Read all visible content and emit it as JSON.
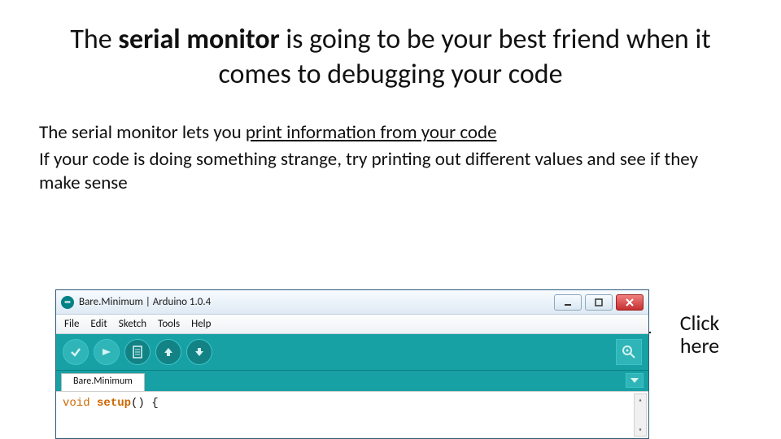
{
  "title": {
    "pre": "The ",
    "bold": "serial monitor",
    "post": " is going to be your best friend when it comes to debugging your code"
  },
  "body": {
    "line1_pre": "The serial monitor lets you ",
    "line1_u": "print information from your code",
    "line2": "If your code is doing something strange, try printing out different values and see if they make sense"
  },
  "annotation": {
    "l1": "Click",
    "l2": "here"
  },
  "arduino": {
    "app_icon_text": "∞",
    "window_title": "Bare.Minimum | Arduino 1.0.4",
    "menu": {
      "file": "File",
      "edit": "Edit",
      "sketch": "Sketch",
      "tools": "Tools",
      "help": "Help"
    },
    "toolbar_icons": {
      "verify": "verify-icon",
      "upload": "upload-icon",
      "new": "new-icon",
      "open": "open-icon",
      "save": "save-icon",
      "serial": "serial-monitor-icon"
    },
    "tab_name": "Bare.Minimum",
    "code": {
      "kw_void": "void",
      "kw_setup": "setup",
      "rest": "() {"
    }
  }
}
